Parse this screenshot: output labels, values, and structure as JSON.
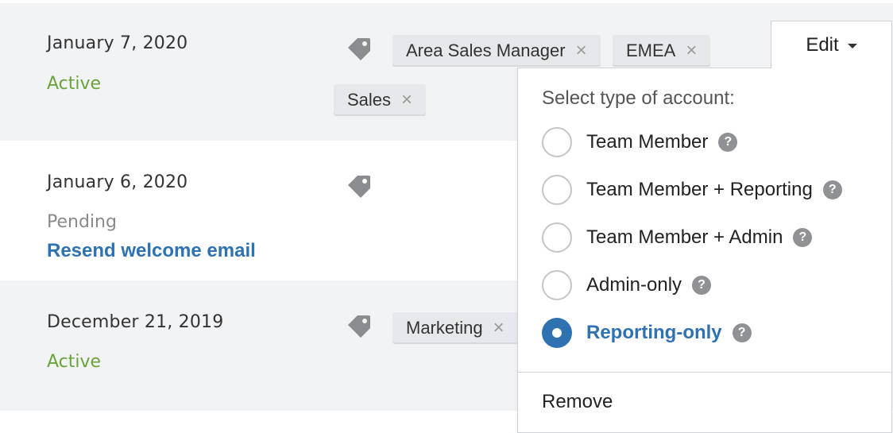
{
  "rows": [
    {
      "date": "January 7, 2020",
      "status": "Active",
      "tags": [
        "Area Sales Manager",
        "EMEA",
        "Sales"
      ]
    },
    {
      "date": "January 6, 2020",
      "status": "Pending",
      "action_link": "Resend welcome email",
      "tags": []
    },
    {
      "date": "December 21, 2019",
      "status": "Active",
      "tags": [
        "Marketing"
      ]
    }
  ],
  "tag_remove_symbol": "×",
  "edit_button": {
    "label": "Edit"
  },
  "account_menu": {
    "heading": "Select type of account:",
    "options": [
      {
        "label": "Team Member",
        "selected": false,
        "help": "?"
      },
      {
        "label": "Team Member + Reporting",
        "selected": false,
        "help": "?"
      },
      {
        "label": "Team Member + Admin",
        "selected": false,
        "help": "?"
      },
      {
        "label": "Admin-only",
        "selected": false,
        "help": "?"
      },
      {
        "label": "Reporting-only",
        "selected": true,
        "help": "?"
      }
    ],
    "remove_label": "Remove"
  },
  "colors": {
    "active_status": "#6aa33a",
    "pending_status": "#8a8a8a",
    "link": "#2f72b2",
    "row_shade": "#f2f3f5"
  },
  "icons": [
    "tag-icon",
    "remove-tag-icon",
    "caret-down-icon",
    "help-icon",
    "radio-selected-icon"
  ]
}
